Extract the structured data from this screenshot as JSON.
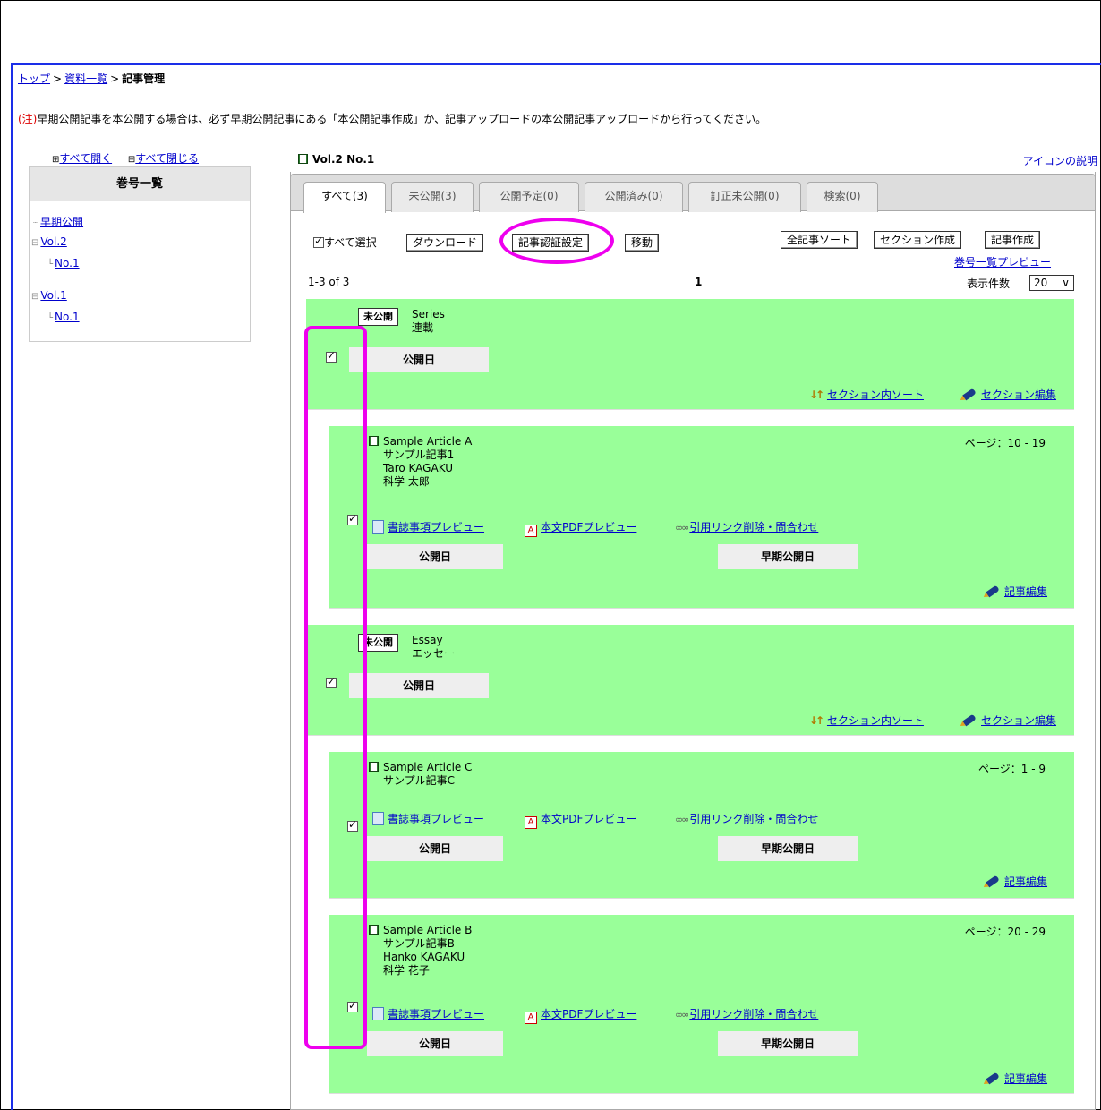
{
  "breadcrumb": {
    "top": "トップ",
    "list": "資料一覧",
    "current": "記事管理",
    "sep": ">"
  },
  "notice": {
    "mark": "(注)",
    "text": "早期公開記事を本公開する場合は、必ず早期公開記事にある「本公開記事作成」か、記事アップロードの本公開記事アップロードから行ってください。"
  },
  "tree": {
    "expand_all": "すべて開く",
    "collapse_all": "すべて閉じる",
    "heading": "巻号一覧",
    "early": "早期公開",
    "vol2": "Vol.2",
    "vol2_no1": "No.1",
    "vol1": "Vol.1",
    "vol1_no1": "No.1"
  },
  "volume_title": "Vol.2 No.1",
  "icon_help": "アイコンの説明",
  "tabs": [
    "すべて(3)",
    "未公開(3)",
    "公開予定(0)",
    "公開済み(0)",
    "訂正未公開(0)",
    "検索(0)"
  ],
  "toolbar": {
    "select_all": "すべて選択",
    "download": "ダウンロード",
    "auth": "記事認証設定",
    "move": "移動",
    "sort_all": "全記事ソート",
    "create_section": "セクション作成",
    "create_article": "記事作成",
    "preview": "巻号一覧プレビュー",
    "range": "1-3 of 3",
    "page": "1",
    "per_page_label": "表示件数",
    "per_page": "20"
  },
  "labels": {
    "unpublished": "未公開",
    "pub_date": "公開日",
    "early_date": "早期公開日",
    "section_sort": "セクション内ソート",
    "section_edit": "セクション編集",
    "biblio_preview": "書誌事項プレビュー",
    "pdf_preview": "本文PDFプレビュー",
    "ref_link": "引用リンク削除・問合わせ",
    "article_edit": "記事編集"
  },
  "sections": [
    {
      "en": "Series",
      "ja": "連載"
    },
    {
      "en": "Essay",
      "ja": "エッセー"
    }
  ],
  "articles": [
    {
      "title_en": "Sample Article A",
      "title_ja": "サンプル記事1",
      "author_en": "Taro KAGAKU",
      "author_ja": "科学 太郎",
      "pages": "ページ：10 - 19"
    },
    {
      "title_en": "Sample Article C",
      "title_ja": "サンプル記事C",
      "pages": "ページ：1 - 9"
    },
    {
      "title_en": "Sample Article B",
      "title_ja": "サンプル記事B",
      "author_en": "Hanko KAGAKU",
      "author_ja": "科学 花子",
      "pages": "ページ：20 - 29"
    }
  ],
  "colors": {
    "row_green": "#99ff99",
    "highlight": "#ee00ee",
    "frame_blue": "#1a2ee8"
  }
}
